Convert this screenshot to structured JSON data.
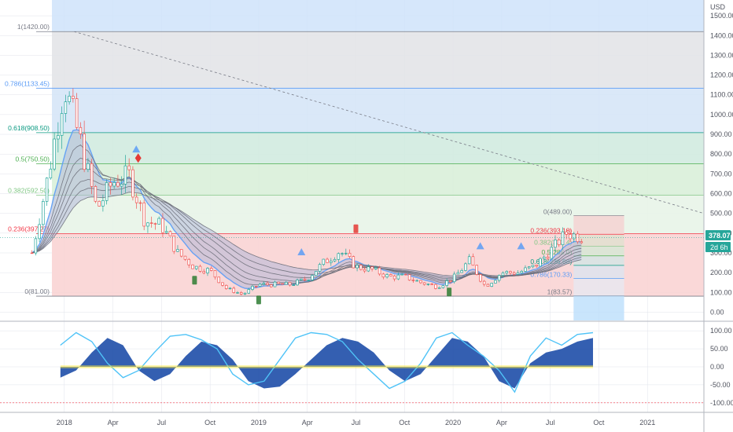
{
  "currency": "USD",
  "current_price": "378.07",
  "countdown": "2d 6h",
  "colors": {
    "bull": "#26a69a",
    "bear": "#ef5350",
    "up": "#2196f3",
    "grid": "#e0e3eb",
    "text": "#50535e"
  },
  "chart_data": [
    {
      "type": "line",
      "panel": "main",
      "title": "",
      "x_ticks": [
        "2018",
        "Apr",
        "Jul",
        "Oct",
        "2019",
        "Apr",
        "Jul",
        "Oct",
        "2020",
        "Apr",
        "Jul",
        "Oct",
        "2021"
      ],
      "y_ticks": [
        0,
        100,
        200,
        300,
        400,
        500,
        600,
        700,
        800,
        900,
        1000,
        1100,
        1200,
        1300,
        1400,
        1500
      ],
      "ylim": [
        -30,
        1560
      ],
      "price_series": {
        "x": [
          "2017-11",
          "2017-12",
          "2018-01",
          "2018-02",
          "2018-03",
          "2018-04",
          "2018-05",
          "2018-06",
          "2018-07",
          "2018-08",
          "2018-09",
          "2018-10",
          "2018-11",
          "2018-12",
          "2019-01",
          "2019-02",
          "2019-03",
          "2019-04",
          "2019-05",
          "2019-06",
          "2019-07",
          "2019-08",
          "2019-09",
          "2019-10",
          "2019-11",
          "2019-12",
          "2020-01",
          "2020-02",
          "2020-03",
          "2020-04",
          "2020-05",
          "2020-06",
          "2020-07",
          "2020-08",
          "2020-09"
        ],
        "close": [
          300,
          690,
          1150,
          860,
          520,
          660,
          690,
          460,
          440,
          300,
          230,
          210,
          120,
          90,
          140,
          140,
          140,
          170,
          250,
          310,
          230,
          215,
          180,
          180,
          150,
          130,
          170,
          260,
          130,
          200,
          200,
          230,
          310,
          400,
          378
        ]
      },
      "fib_retracement_1": {
        "labels": [
          "1(1420.00)",
          "0.786(1133.45)",
          "0.618(908.50)",
          "0.5(750.50)",
          "0.382(592.50)",
          "0.236(397.27)",
          "0(81.00)"
        ],
        "levels": [
          1420,
          1133.45,
          908.5,
          750.5,
          592.5,
          397.27,
          81
        ]
      },
      "fib_retracement_2": {
        "labels": [
          "0(489.00)",
          "0.236(393.18)",
          "0.382(333.4)",
          "0.5(285.0)",
          "0.618(236.68)",
          "0.786(170.33)",
          "1(83.57)"
        ],
        "levels": [
          489,
          393.18,
          333.4,
          285,
          236.68,
          170.33,
          83.57
        ]
      }
    },
    {
      "type": "area",
      "panel": "oscillator",
      "y_ticks": [
        100,
        50,
        0,
        -50,
        -100
      ],
      "ylim": [
        -120,
        120
      ],
      "series": [
        {
          "values": [
            60,
            95,
            70,
            10,
            -30,
            -10,
            40,
            85,
            90,
            75,
            50,
            -20,
            -50,
            -40,
            20,
            80,
            95,
            90,
            70,
            20,
            -20,
            -60,
            -40,
            10,
            80,
            95,
            60,
            30,
            -10,
            -70,
            30,
            80,
            60,
            90,
            95
          ]
        },
        {
          "values": [
            -30,
            -10,
            40,
            80,
            60,
            -10,
            -40,
            -20,
            30,
            70,
            60,
            20,
            -40,
            -60,
            -55,
            -20,
            20,
            60,
            80,
            70,
            40,
            -10,
            -40,
            -20,
            30,
            80,
            70,
            30,
            -40,
            -60,
            10,
            40,
            50,
            70,
            80
          ]
        }
      ]
    }
  ]
}
